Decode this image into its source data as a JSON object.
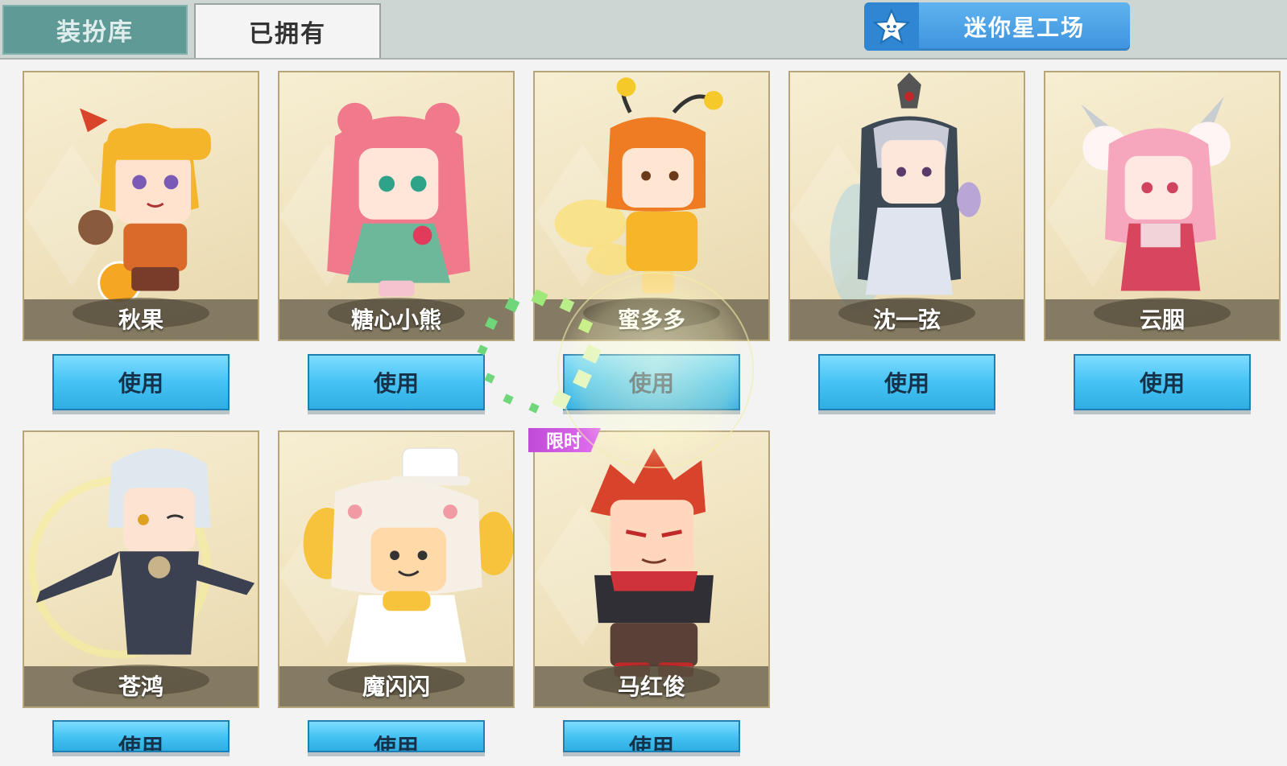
{
  "tabs": {
    "library": "装扮库",
    "owned": "已拥有"
  },
  "workshop": {
    "label": "迷你星工场",
    "icon": "star-icon"
  },
  "use_label": "使用",
  "limited_badge": "限时",
  "characters": [
    {
      "name": "秋果",
      "hair": "#f5b52a",
      "outfit": "#d96a2a",
      "skin": "#ffe3cf"
    },
    {
      "name": "糖心小熊",
      "hair": "#f07a8c",
      "outfit": "#6db89a",
      "skin": "#ffe6d9"
    },
    {
      "name": "蜜多多",
      "hair": "#ef7b22",
      "outfit": "#f7b52a",
      "skin": "#ffe6d2"
    },
    {
      "name": "沈一弦",
      "hair": "#c9ccd6",
      "outfit": "#dfe4ee",
      "skin": "#fde7da"
    },
    {
      "name": "云胭",
      "hair": "#f6a7bd",
      "outfit": "#d8455e",
      "skin": "#ffe8e2"
    },
    {
      "name": "苍鸿",
      "hair": "#dfe8ee",
      "outfit": "#3b4150",
      "skin": "#fde3d2"
    },
    {
      "name": "魔闪闪",
      "hair": "#f6efe6",
      "outfit": "#f7c23c",
      "skin": "#ffd9a8"
    },
    {
      "name": "马红俊",
      "hair": "#d8442b",
      "outfit": "#5a4036",
      "skin": "#ffd7bd"
    }
  ]
}
